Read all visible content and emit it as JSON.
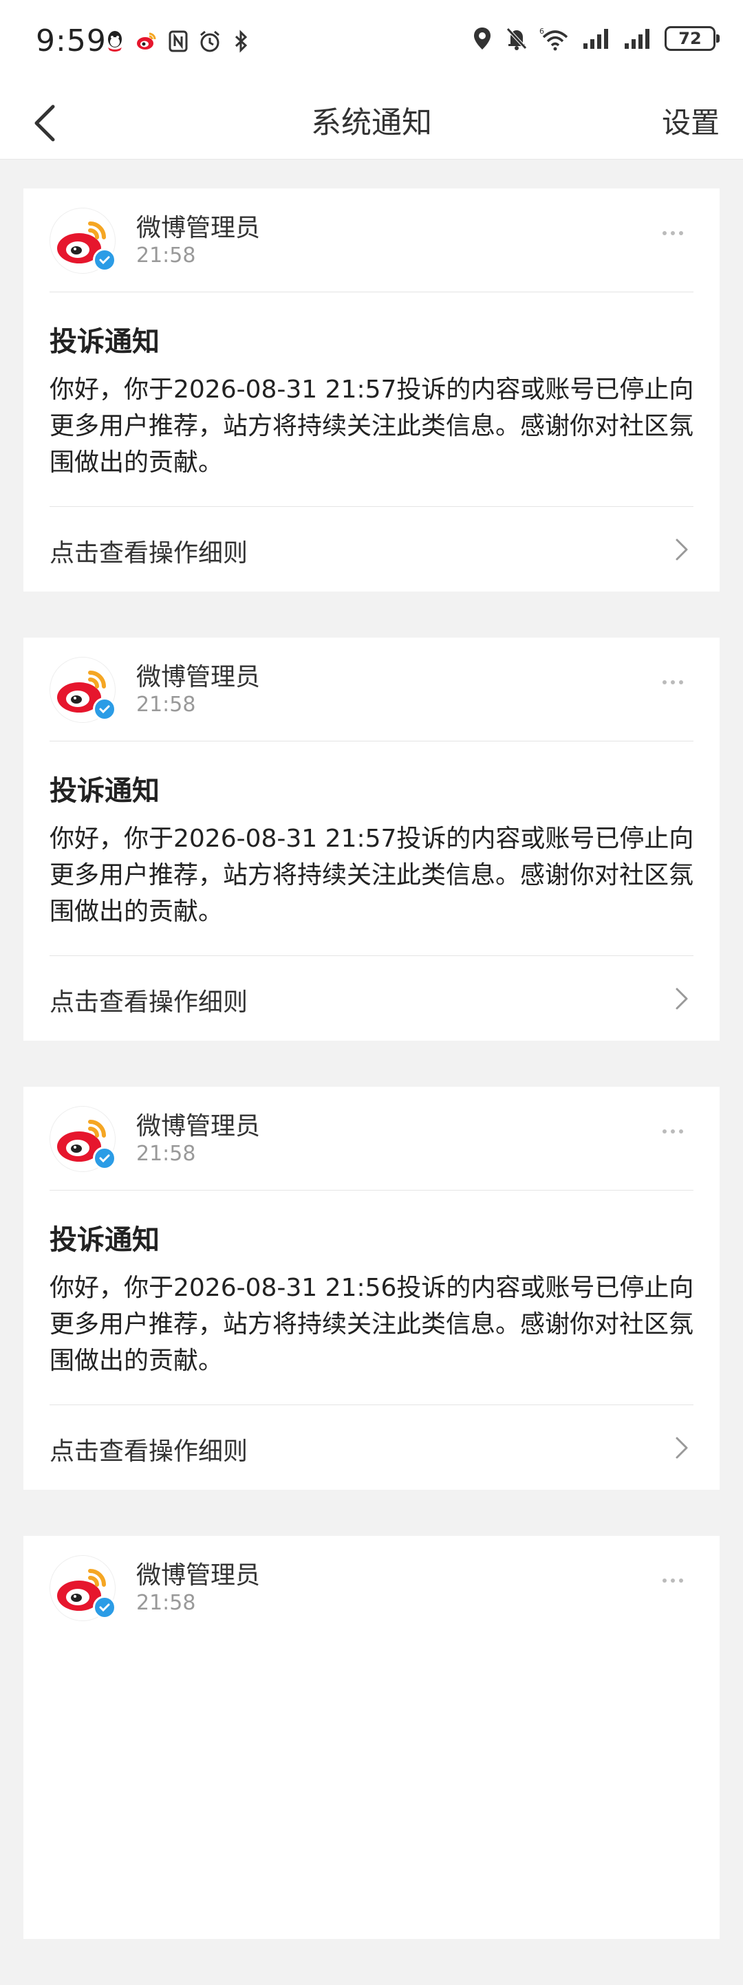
{
  "status_bar": {
    "time": "9:59",
    "battery": "72",
    "left_icons": [
      "qq-icon",
      "weibo-icon",
      "nfc-icon",
      "alarm-icon",
      "bluetooth-icon"
    ],
    "right_icons": [
      "location-icon",
      "mute-icon",
      "wifi-icon",
      "signal-icon",
      "signal-icon"
    ]
  },
  "nav": {
    "title": "系统通知",
    "settings_label": "设置"
  },
  "colors": {
    "accent_blue": "#2b9ce6",
    "weibo_red": "#e6162d",
    "weibo_orange": "#f5a623",
    "background": "#f2f2f2"
  },
  "notifications": [
    {
      "sender": "微博管理员",
      "time": "21:58",
      "title": "投诉通知",
      "body": "你好，你于2026-08-31 21:57投诉的内容或账号已停止向更多用户推荐，站方将持续关注此类信息。感谢你对社区氛围做出的贡献。",
      "link_label": "点击查看操作细则"
    },
    {
      "sender": "微博管理员",
      "time": "21:58",
      "title": "投诉通知",
      "body": "你好，你于2026-08-31 21:57投诉的内容或账号已停止向更多用户推荐，站方将持续关注此类信息。感谢你对社区氛围做出的贡献。",
      "link_label": "点击查看操作细则"
    },
    {
      "sender": "微博管理员",
      "time": "21:58",
      "title": "投诉通知",
      "body": "你好，你于2026-08-31 21:56投诉的内容或账号已停止向更多用户推荐，站方将持续关注此类信息。感谢你对社区氛围做出的贡献。",
      "link_label": "点击查看操作细则"
    },
    {
      "sender": "微博管理员",
      "time": "21:58",
      "title": "",
      "body": "",
      "link_label": ""
    }
  ]
}
